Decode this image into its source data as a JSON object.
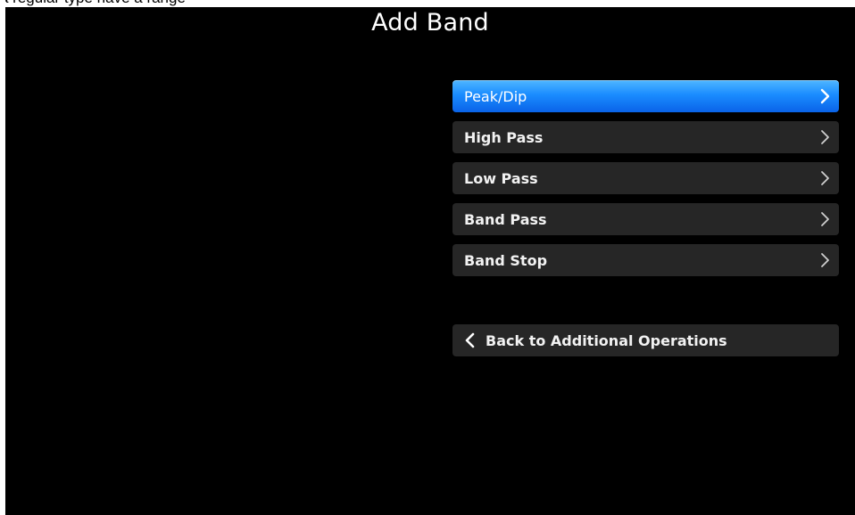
{
  "header": {
    "top_strip_text": "a regular type have a range"
  },
  "page": {
    "title": "Add Band"
  },
  "menu": {
    "items": [
      {
        "label": "Peak/Dip",
        "selected": true,
        "icon": "chevron-right-icon"
      },
      {
        "label": "High Pass",
        "selected": false,
        "icon": "chevron-right-icon"
      },
      {
        "label": "Low Pass",
        "selected": false,
        "icon": "chevron-right-icon"
      },
      {
        "label": "Band Pass",
        "selected": false,
        "icon": "chevron-right-icon"
      },
      {
        "label": "Band Stop",
        "selected": false,
        "icon": "chevron-right-icon"
      }
    ]
  },
  "back": {
    "label": "Back to Additional Operations",
    "icon": "chevron-left-icon"
  },
  "colors": {
    "background": "#000000",
    "item_background": "#262626",
    "selected_top": "#4fb6ff",
    "selected_bottom": "#0a63e8",
    "text": "#ffffff"
  }
}
